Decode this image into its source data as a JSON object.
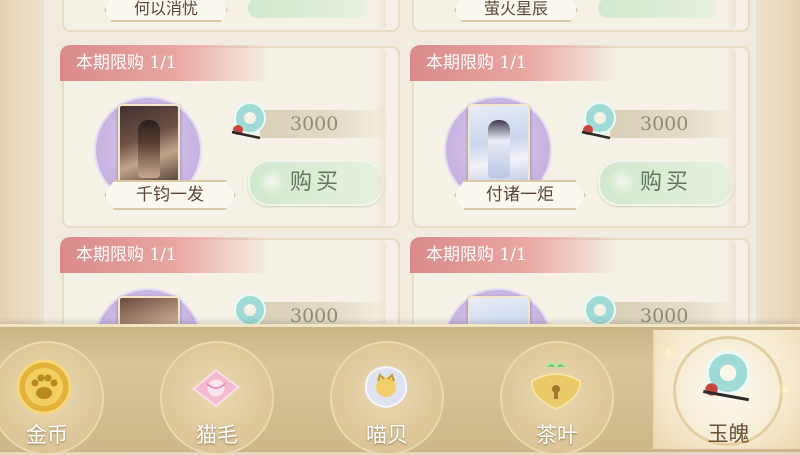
{
  "top_cards": [
    {
      "name": "何以消忧"
    },
    {
      "name": "萤火星辰"
    }
  ],
  "cards": [
    {
      "ribbon": "本期限购 1/1",
      "name": "千钧一发",
      "price": "3000",
      "buy_label": "购买"
    },
    {
      "ribbon": "本期限购 1/1",
      "name": "付诸一炬",
      "price": "3000",
      "buy_label": "购买"
    },
    {
      "ribbon": "本期限购 1/1",
      "price": "3000"
    },
    {
      "ribbon": "本期限购 1/1",
      "price": "3000"
    }
  ],
  "tabs": [
    {
      "label": "金币",
      "icon": "gold-coin-icon"
    },
    {
      "label": "猫毛",
      "icon": "cat-fur-icon"
    },
    {
      "label": "喵贝",
      "icon": "shell-icon"
    },
    {
      "label": "茶叶",
      "icon": "tea-lock-icon"
    },
    {
      "label": "玉魄",
      "icon": "jade-ring-icon",
      "active": true
    }
  ],
  "colors": {
    "accent_ribbon": "#d98a8a",
    "buy_button": "#d2e7cf",
    "portrait_circle": "#c7b2e0"
  }
}
